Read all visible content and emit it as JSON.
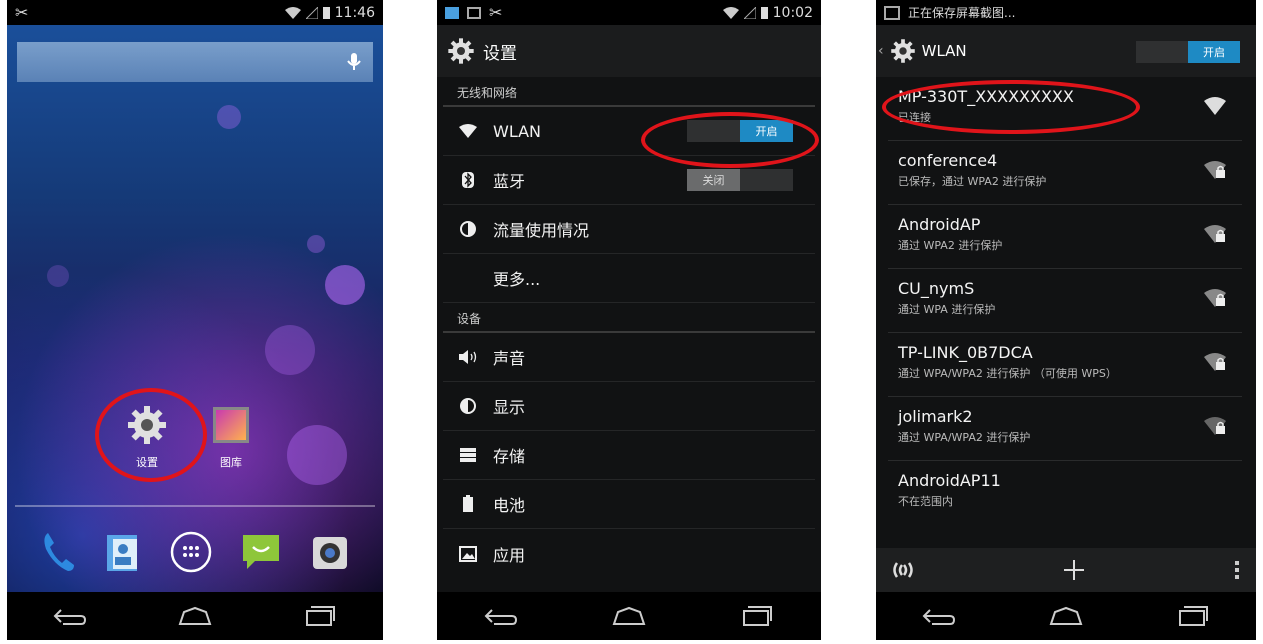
{
  "home": {
    "status_time": "11:46",
    "apps": [
      {
        "label": "设置",
        "icon": "gear-icon"
      },
      {
        "label": "图库",
        "icon": "gallery-icon"
      }
    ],
    "dock": [
      "phone-icon",
      "contacts-icon",
      "all-apps-icon",
      "messaging-icon",
      "camera-icon"
    ]
  },
  "settings": {
    "status_time": "10:02",
    "title": "设置",
    "sections": [
      {
        "header": "无线和网络",
        "items": [
          {
            "label": "WLAN",
            "icon": "wifi-icon",
            "switch": "开启",
            "state": "on"
          },
          {
            "label": "蓝牙",
            "icon": "bluetooth-icon",
            "switch": "关闭",
            "state": "off"
          },
          {
            "label": "流量使用情况",
            "icon": "data-usage-icon"
          },
          {
            "label": "更多...",
            "icon": ""
          }
        ]
      },
      {
        "header": "设备",
        "items": [
          {
            "label": "声音",
            "icon": "sound-icon"
          },
          {
            "label": "显示",
            "icon": "display-icon"
          },
          {
            "label": "存储",
            "icon": "storage-icon"
          },
          {
            "label": "电池",
            "icon": "battery-icon"
          },
          {
            "label": "应用",
            "icon": "apps-icon"
          }
        ]
      }
    ]
  },
  "wlan": {
    "status_text": "正在保存屏幕截图...",
    "title": "WLAN",
    "switch": "开启",
    "networks": [
      {
        "ssid": "MP-330T_XXXXXXXXX",
        "status": "已连接",
        "secured": false
      },
      {
        "ssid": "conference4",
        "status": "已保存，通过 WPA2 进行保护",
        "secured": true
      },
      {
        "ssid": "AndroidAP",
        "status": "通过 WPA2 进行保护",
        "secured": true
      },
      {
        "ssid": "CU_nymS",
        "status": "通过 WPA 进行保护",
        "secured": true
      },
      {
        "ssid": "TP-LINK_0B7DCA",
        "status": "通过 WPA/WPA2 进行保护 （可使用 WPS）",
        "secured": true
      },
      {
        "ssid": "jolimark2",
        "status": "通过 WPA/WPA2 进行保护",
        "secured": true
      },
      {
        "ssid": "AndroidAP11",
        "status": "不在范围内",
        "secured": false
      }
    ]
  },
  "colors": {
    "accent": "#1e8ac4",
    "highlight": "#e0141a"
  }
}
